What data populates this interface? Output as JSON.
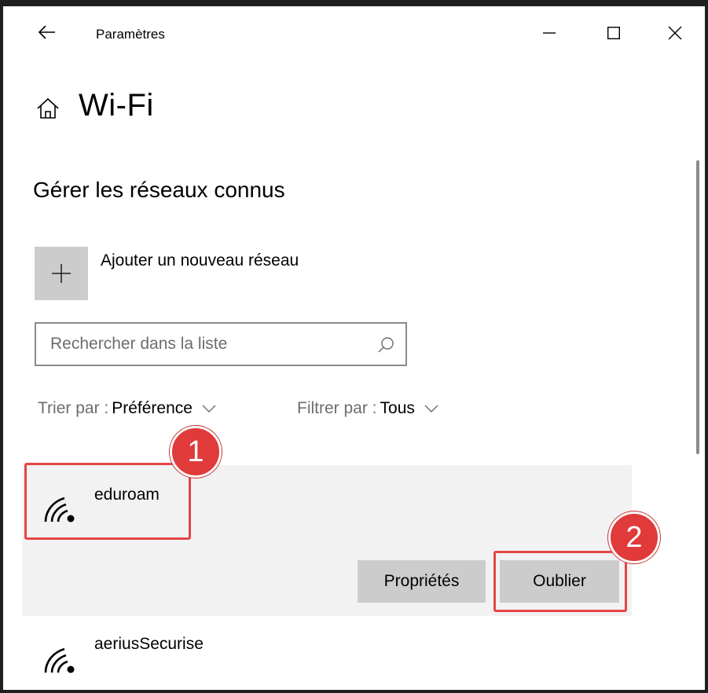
{
  "window": {
    "app_title": "Paramètres",
    "back_icon": "arrow-left-icon",
    "controls": {
      "minimize_icon": "minimize-icon",
      "maximize_icon": "maximize-icon",
      "close_icon": "close-icon"
    }
  },
  "header": {
    "home_icon": "home-icon",
    "title": "Wi-Fi"
  },
  "section": {
    "title": "Gérer les réseaux connus",
    "add_network_label": "Ajouter un nouveau réseau",
    "add_icon": "plus-icon"
  },
  "search": {
    "placeholder": "Rechercher dans la liste",
    "value": "",
    "icon": "search-icon"
  },
  "sort": {
    "label": "Trier par :",
    "value": "Préférence"
  },
  "filter": {
    "label": "Filtrer par :",
    "value": "Tous"
  },
  "networks": [
    {
      "name": "eduroam",
      "selected": true,
      "icon": "wifi-icon"
    },
    {
      "name": "aeriusSecurise",
      "selected": false,
      "icon": "wifi-icon"
    }
  ],
  "actions": {
    "properties_label": "Propriétés",
    "forget_label": "Oublier"
  },
  "annotations": {
    "badge_1": "1",
    "badge_2": "2",
    "color": "#e03a3a"
  }
}
